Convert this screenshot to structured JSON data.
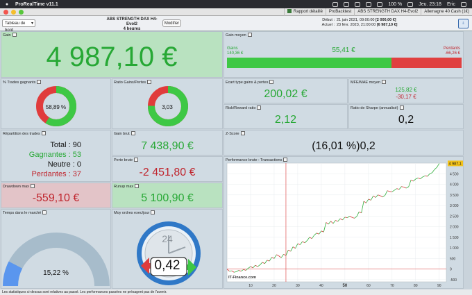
{
  "menubar": {
    "app_title": "ProRealTime v11.1",
    "battery": "100 %",
    "datetime": "Jeu. 23:18",
    "user": "Eric"
  },
  "tabs": [
    "Rapport détaillé",
    "ProBacktest",
    "ABS STRENGTH DAX H4-Evol2",
    "Allemagne 40 Cash (1€)"
  ],
  "toolbar": {
    "view_select": "Tableau de bord",
    "strategy_name": "ABS STRENGTH DAX H4-Evol2",
    "timeframe": "4 heures",
    "modify_label": "Modifier",
    "start_label": "Début :",
    "start_value": "21 juin 2021, 09:00:00",
    "start_amount": "[2 000,00 €]",
    "current_label": "Actuel :",
    "current_value": "23 févr. 2023, 21:00:00",
    "current_amount": "[6 987,10 €]"
  },
  "gain": {
    "title": "Gain",
    "value": "4 987,10 €"
  },
  "gain_moyen": {
    "title": "Gain moyen",
    "gains_label": "Gains",
    "gains_value": "140,36 €",
    "center_value": "55,41 €",
    "losses_label": "Perdants",
    "losses_value": "-66,26 €",
    "win_fraction": 0.7
  },
  "trades_gagnants": {
    "title": "% Trades gagnants",
    "value": "58,89 %",
    "fraction": 0.5889
  },
  "ratio_gains_pertes": {
    "title": "Ratio Gains/Pertes",
    "value": "3,03",
    "fraction": 0.752
  },
  "ecart_type": {
    "title": "Ecart type gains & pertes",
    "value": "200,02 €"
  },
  "mfe_mae": {
    "title": "MFE/MAE moyen",
    "mfe": "125,82 €",
    "mae": "-30,17 €"
  },
  "risk_reward": {
    "title": "Risk/Reward ratio",
    "value": "2,12"
  },
  "sharpe": {
    "title": "Ratio de Sharpe (annualisé)",
    "value": "0,2"
  },
  "repartition": {
    "title": "Répartition des trades",
    "total": "Total : 90",
    "gagnantes": "Gagnantes : 53",
    "neutre": "Neutre : 0",
    "perdantes": "Perdantes : 37"
  },
  "gain_brut": {
    "title": "Gain brut",
    "value": "7 438,90 €"
  },
  "zscore": {
    "title": "Z-Score",
    "value": "(16,01 %)",
    "value2": "0,2"
  },
  "perte_brute": {
    "title": "Perte brute",
    "value": "-2 451,80 €"
  },
  "drawdown": {
    "title": "Drawdown max",
    "value": "-559,10 €"
  },
  "runup": {
    "title": "Runup max",
    "value": "5 100,90 €"
  },
  "temps_marche": {
    "title": "Temps dans le marché",
    "value": "15,22 %",
    "fraction": 0.1522
  },
  "moy_ordres": {
    "title": "Moy ordres exec/jour",
    "value": "0,42",
    "clock": "24"
  },
  "performance": {
    "title": "Performance brute : Transactions",
    "watermark": "IT-Finance.com",
    "last_value_label": "4 987,1",
    "y_ticks": [
      "4 500",
      "4 000",
      "3 500",
      "3 000",
      "2 500",
      "2 000",
      "1 500",
      "1 000",
      "500",
      "0",
      "-500"
    ],
    "x_ticks": [
      "10",
      "20",
      "30",
      "40",
      "50",
      "60",
      "70",
      "80",
      "90"
    ],
    "x_bold_index": 4
  },
  "chart_data": {
    "type": "line",
    "title": "Performance brute : Transactions",
    "x": [
      0,
      1,
      2,
      3,
      4,
      5,
      6,
      7,
      8,
      9,
      10,
      11,
      12,
      13,
      14,
      15,
      16,
      17,
      18,
      19,
      20,
      21,
      22,
      23,
      24,
      25,
      26,
      27,
      28,
      29,
      30,
      31,
      32,
      33,
      34,
      35,
      36,
      37,
      38,
      39,
      40,
      41,
      42,
      43,
      44,
      45,
      46,
      47,
      48,
      49,
      50,
      51,
      52,
      53,
      54,
      55,
      56,
      57,
      58,
      59,
      60,
      61,
      62,
      63,
      64,
      65,
      66,
      67,
      68,
      69,
      70,
      71,
      72,
      73,
      74,
      75,
      76,
      77,
      78,
      79,
      80,
      81,
      82,
      83,
      84,
      85,
      86,
      87,
      88,
      89,
      90
    ],
    "values": [
      0,
      -100,
      -80,
      -150,
      -120,
      -60,
      -100,
      -20,
      -60,
      40,
      120,
      60,
      180,
      120,
      200,
      320,
      260,
      420,
      380,
      560,
      500,
      680,
      620,
      540,
      700,
      640,
      900,
      840,
      1050,
      980,
      1200,
      1150,
      1300,
      1240,
      1350,
      1500,
      1440,
      1600,
      1700,
      1650,
      1800,
      1750,
      2200,
      2120,
      2260,
      2150,
      2300,
      2250,
      2380,
      2320,
      2450,
      2420,
      2500,
      2440,
      2400,
      2480,
      2700,
      2650,
      3200,
      3120,
      3300,
      3250,
      3450,
      3380,
      3500,
      3460,
      3400,
      3480,
      3700,
      3660,
      3650,
      3720,
      3800,
      3760,
      3900,
      3860,
      3820,
      3880,
      4200,
      4150,
      4250,
      4300,
      4260,
      4350,
      4400,
      4380,
      4500,
      4550,
      4700,
      4800,
      4987
    ],
    "xlim": [
      0,
      93
    ],
    "ylim": [
      -600,
      5000
    ],
    "vline_x": 25,
    "hline_y": 0
  }
}
